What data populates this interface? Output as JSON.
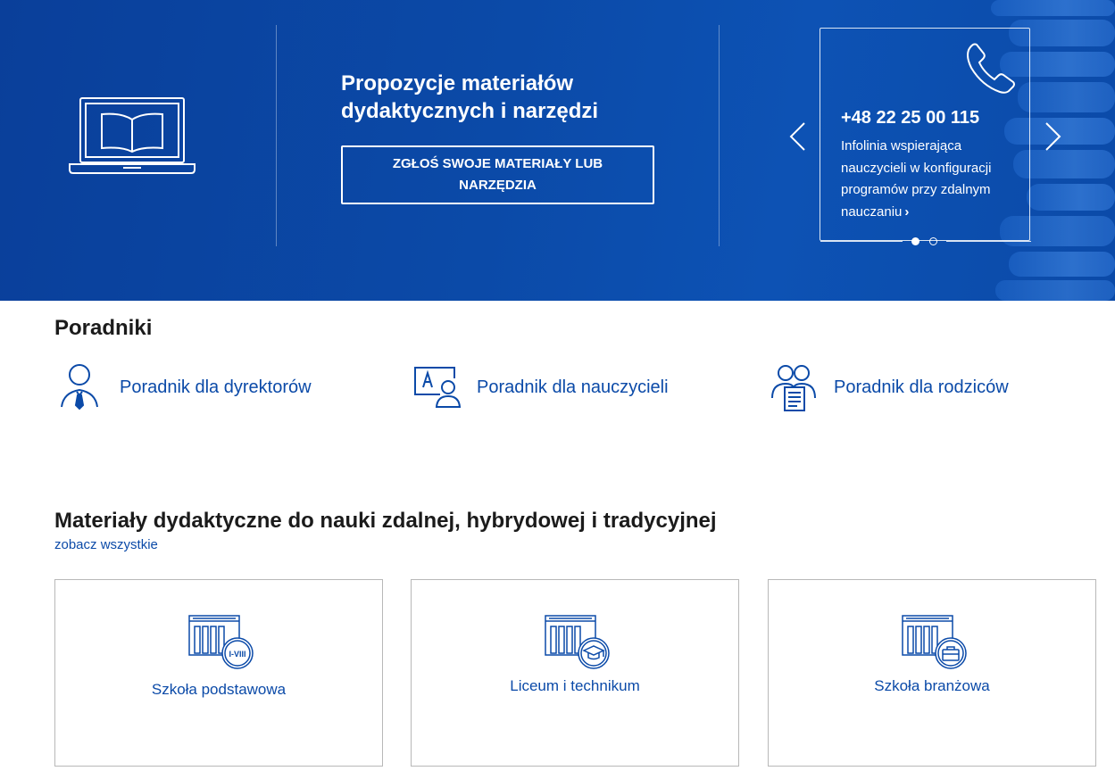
{
  "hero": {
    "title": "Propozycje materiałów dydaktycznych i narzędzi",
    "button_label": "ZGŁOŚ SWOJE MATERIAŁY LUB NARZĘDZIA",
    "icon": "laptop-book-icon",
    "carousel": {
      "phone": "+48 22 25 00 115",
      "description": "Infolinia wspierająca nauczycieli w konfiguracji programów przy zdalnym nauczaniu",
      "link_chevron": "›",
      "icon": "phone-icon",
      "active_slide": 1,
      "slide_count": 2
    }
  },
  "guides": {
    "title": "Poradniki",
    "items": [
      {
        "label": "Poradnik dla dyrektorów",
        "icon": "director-icon"
      },
      {
        "label": "Poradnik dla nauczycieli",
        "icon": "teacher-board-icon"
      },
      {
        "label": "Poradnik dla rodziców",
        "icon": "parents-document-icon"
      }
    ]
  },
  "materials": {
    "title": "Materiały dydaktyczne do nauki zdalnej, hybrydowej i tradycyjnej",
    "see_all": "zobacz wszystkie",
    "cards": [
      {
        "label": "Szkoła podstawowa",
        "badge": "I-VIII",
        "icon": "school-primary-icon"
      },
      {
        "label": "Liceum i technikum",
        "icon": "school-graduation-cap-icon"
      },
      {
        "label": "Szkoła branżowa",
        "icon": "school-briefcase-icon"
      }
    ]
  },
  "colors": {
    "hero_background": "#0b4aa8",
    "accent": "#0b4aa8",
    "text": "#1b1b1b",
    "card_border": "#b8b8b8"
  }
}
